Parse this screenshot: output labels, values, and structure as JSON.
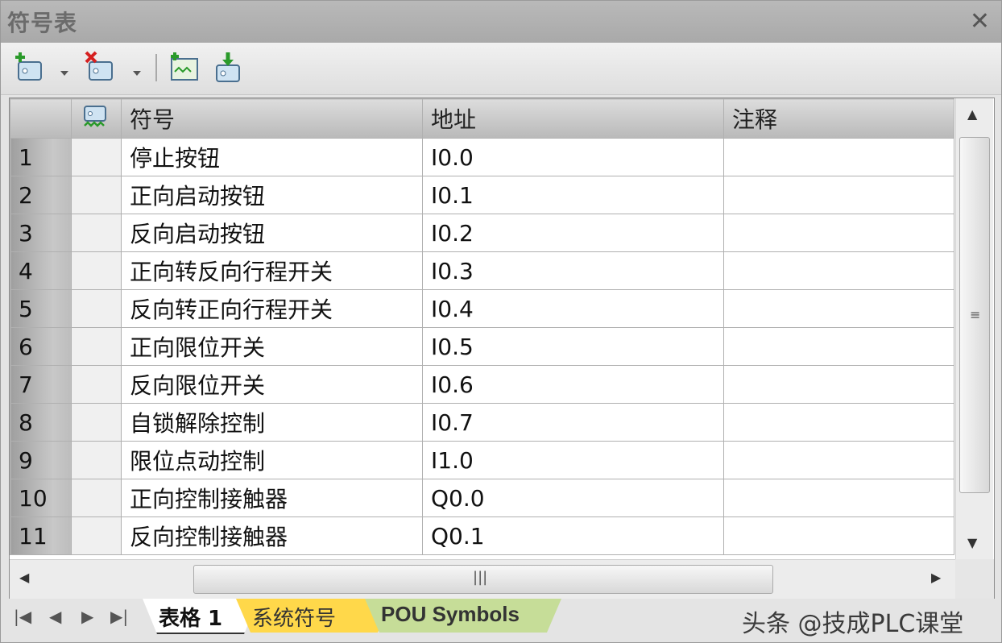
{
  "window": {
    "title": "符号表",
    "close_label": "✕"
  },
  "toolbar": {
    "icons": [
      "add-symbol-icon",
      "delete-symbol-icon",
      "create-table-icon",
      "import-icon"
    ]
  },
  "table": {
    "headers": {
      "icon": "tag-icon",
      "symbol": "符号",
      "address": "地址",
      "comment": "注释"
    },
    "rows": [
      {
        "num": "1",
        "symbol": "停止按钮",
        "address": "I0.0",
        "comment": ""
      },
      {
        "num": "2",
        "symbol": "正向启动按钮",
        "address": "I0.1",
        "comment": ""
      },
      {
        "num": "3",
        "symbol": "反向启动按钮",
        "address": "I0.2",
        "comment": ""
      },
      {
        "num": "4",
        "symbol": "正向转反向行程开关",
        "address": "I0.3",
        "comment": ""
      },
      {
        "num": "5",
        "symbol": "反向转正向行程开关",
        "address": "I0.4",
        "comment": ""
      },
      {
        "num": "6",
        "symbol": "正向限位开关",
        "address": "I0.5",
        "comment": ""
      },
      {
        "num": "7",
        "symbol": "反向限位开关",
        "address": "I0.6",
        "comment": ""
      },
      {
        "num": "8",
        "symbol": "自锁解除控制",
        "address": "I0.7",
        "comment": ""
      },
      {
        "num": "9",
        "symbol": "限位点动控制",
        "address": "I1.0",
        "comment": ""
      },
      {
        "num": "10",
        "symbol": "正向控制接触器",
        "address": "Q0.0",
        "comment": ""
      },
      {
        "num": "11",
        "symbol": "反向控制接触器",
        "address": "Q0.1",
        "comment": ""
      }
    ]
  },
  "tabs": [
    {
      "label": "表格 1",
      "active": true
    },
    {
      "label": "系统符号",
      "active": false
    },
    {
      "label": "POU Symbols",
      "active": false
    }
  ],
  "watermark": "头条 @技成PLC课堂",
  "colors": {
    "titlebar": "#a9a9a9",
    "tab_yellow": "#ffd84a",
    "tab_green": "#c6dd98"
  }
}
